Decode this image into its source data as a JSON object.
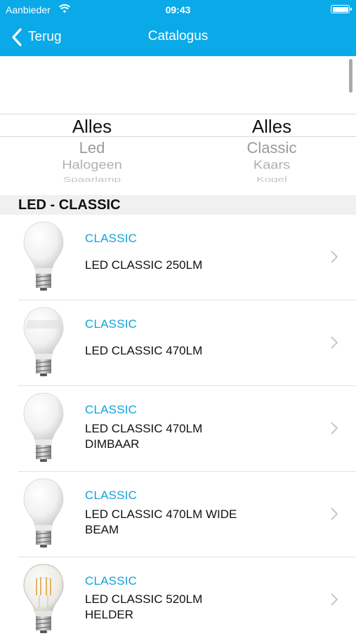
{
  "status_bar": {
    "carrier": "Aanbieder",
    "time": "09:43"
  },
  "nav": {
    "back_label": "Terug",
    "title": "Catalogus"
  },
  "picker": {
    "left": {
      "options": [
        "Alles",
        "Led",
        "Halogeen",
        "Spaarlamp"
      ],
      "selected": "Alles"
    },
    "right": {
      "options": [
        "Alles",
        "Classic",
        "Kaars",
        "Kogel"
      ],
      "selected": "Alles"
    }
  },
  "section": {
    "title": "LED - CLASSIC"
  },
  "products": [
    {
      "category": "CLASSIC",
      "name": "LED CLASSIC 250LM",
      "bulb": "frosted"
    },
    {
      "category": "CLASSIC",
      "name": "LED CLASSIC 470LM",
      "bulb": "frosted"
    },
    {
      "category": "CLASSIC",
      "name": "LED CLASSIC 470LM DIMBAAR",
      "bulb": "frosted"
    },
    {
      "category": "CLASSIC",
      "name": "LED CLASSIC 470LM WIDE BEAM",
      "bulb": "frosted"
    },
    {
      "category": "CLASSIC",
      "name": "LED CLASSIC 520LM HELDER",
      "bulb": "clear-filament"
    }
  ],
  "colors": {
    "accent": "#0aa9e8",
    "category_text": "#10a3dc"
  }
}
